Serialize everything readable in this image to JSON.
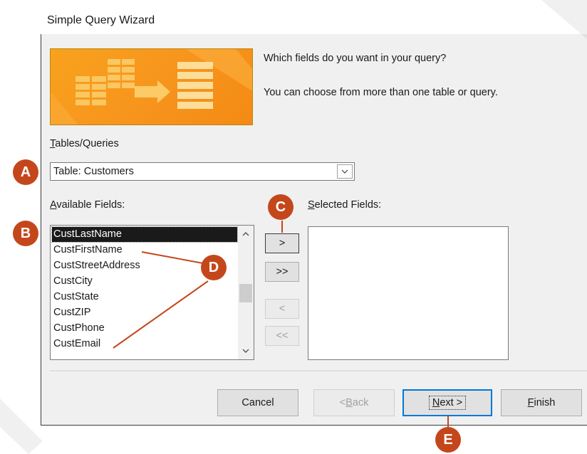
{
  "dialog": {
    "title": "Simple Query Wizard",
    "question": "Which fields do you want in your query?",
    "note": "You can choose from more than one table or query."
  },
  "tables": {
    "label_accel": "T",
    "label_rest": "ables/Queries",
    "selected": "Table: Customers"
  },
  "available": {
    "label_accel": "A",
    "label_rest": "vailable Fields:",
    "items": [
      "CustLastName",
      "CustFirstName",
      "CustStreetAddress",
      "CustCity",
      "CustState",
      "CustZIP",
      "CustPhone",
      "CustEmail"
    ],
    "selected_index": 0
  },
  "selected_fields": {
    "label_accel": "S",
    "label_rest": "elected Fields:"
  },
  "move_buttons": {
    "add_one": ">",
    "add_all": ">>",
    "remove_one": "<",
    "remove_all": "<<"
  },
  "footer": {
    "cancel": "Cancel",
    "back_pre": "< ",
    "back_accel": "B",
    "back_rest": "ack",
    "next_accel": "N",
    "next_rest": "ext >",
    "finish_accel": "F",
    "finish_rest": "inish"
  },
  "callouts": {
    "a": "A",
    "b": "B",
    "c": "C",
    "d": "D",
    "e": "E"
  },
  "colors": {
    "accent": "#0078d7",
    "callout": "#c4471c",
    "banner": "#f7941d"
  }
}
